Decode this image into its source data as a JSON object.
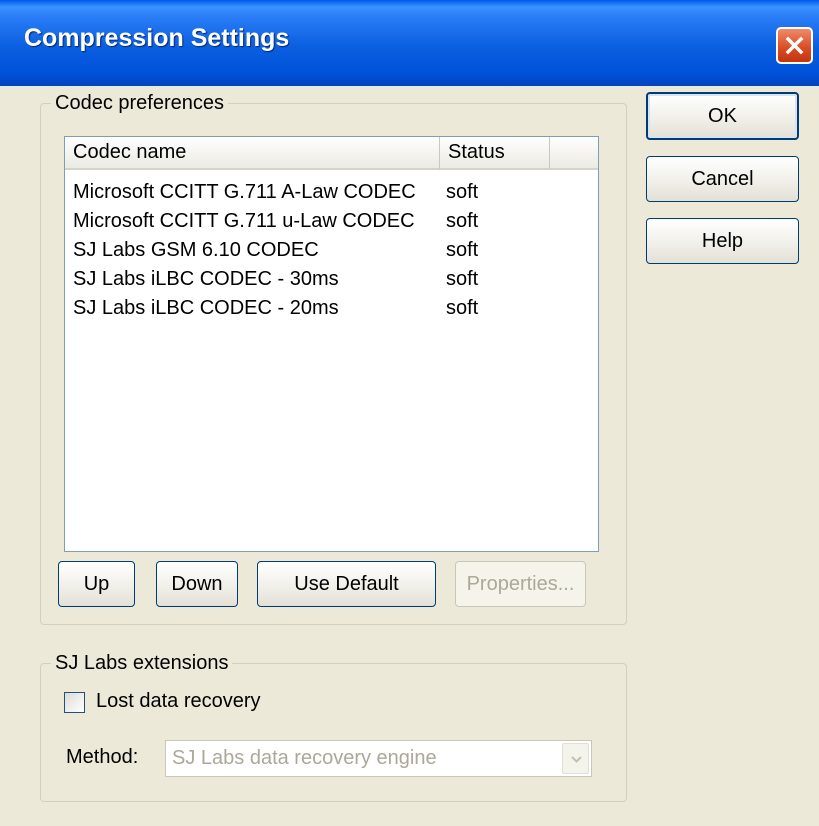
{
  "window": {
    "title": "Compression Settings"
  },
  "codec_group": {
    "legend": "Codec preferences",
    "columns": [
      "Codec name",
      "Status"
    ],
    "rows": [
      {
        "name": "Microsoft CCITT G.711 A-Law CODEC",
        "status": "soft"
      },
      {
        "name": "Microsoft CCITT G.711 u-Law CODEC",
        "status": "soft"
      },
      {
        "name": "SJ Labs GSM 6.10 CODEC",
        "status": "soft"
      },
      {
        "name": "SJ Labs iLBC CODEC - 30ms",
        "status": "soft"
      },
      {
        "name": "SJ Labs iLBC CODEC - 20ms",
        "status": "soft"
      }
    ],
    "buttons": {
      "up": "Up",
      "down": "Down",
      "use_default": "Use Default",
      "properties": "Properties..."
    }
  },
  "side_buttons": {
    "ok": "OK",
    "cancel": "Cancel",
    "help": "Help"
  },
  "extensions_group": {
    "legend": "SJ Labs extensions",
    "checkbox_label": "Lost data recovery",
    "checkbox_checked": false,
    "method_label": "Method:",
    "method_value": "SJ Labs data recovery engine"
  },
  "colors": {
    "titlebar": "#0a5fe0",
    "dialog_bg": "#ece9d8",
    "close_button": "#d94a22"
  },
  "icons": {
    "close": "close-icon",
    "dropdown": "chevron-down-icon"
  }
}
